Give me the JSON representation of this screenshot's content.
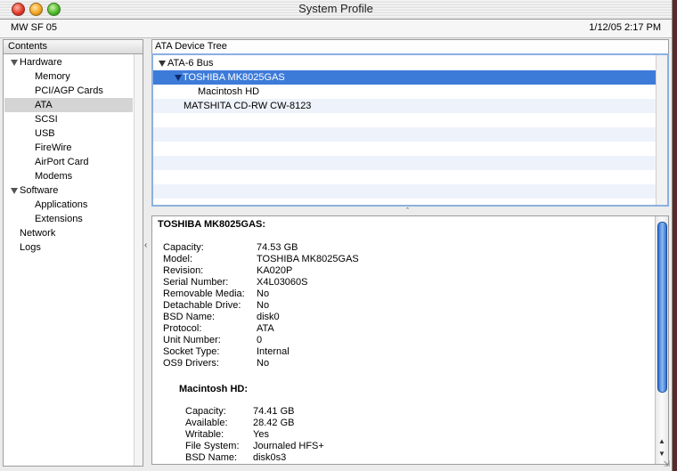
{
  "window": {
    "title": "System Profile",
    "machine_name": "MW SF 05",
    "datetime": "1/12/05 2:17 PM"
  },
  "contents": {
    "header": "Contents",
    "items": [
      {
        "label": "Hardware",
        "level": 0,
        "expanded": true
      },
      {
        "label": "Memory",
        "level": 1
      },
      {
        "label": "PCI/AGP Cards",
        "level": 1
      },
      {
        "label": "ATA",
        "level": 1,
        "selected": true
      },
      {
        "label": "SCSI",
        "level": 1
      },
      {
        "label": "USB",
        "level": 1
      },
      {
        "label": "FireWire",
        "level": 1
      },
      {
        "label": "AirPort Card",
        "level": 1
      },
      {
        "label": "Modems",
        "level": 1
      },
      {
        "label": "Software",
        "level": 0,
        "expanded": true
      },
      {
        "label": "Applications",
        "level": 1
      },
      {
        "label": "Extensions",
        "level": 1
      },
      {
        "label": "Network",
        "level": 0
      },
      {
        "label": "Logs",
        "level": 0
      }
    ]
  },
  "ata_tree": {
    "header": "ATA Device Tree",
    "rows": [
      {
        "label": "ATA-6 Bus"
      },
      {
        "label": "TOSHIBA MK8025GAS",
        "selected": true
      },
      {
        "label": "Macintosh HD"
      },
      {
        "label": "MATSHITA CD-RW CW-8123"
      }
    ]
  },
  "detail": {
    "title": "TOSHIBA MK8025GAS:",
    "fields": [
      {
        "key": "Capacity:",
        "value": "74.53 GB"
      },
      {
        "key": "Model:",
        "value": "TOSHIBA MK8025GAS"
      },
      {
        "key": "Revision:",
        "value": "KA020P"
      },
      {
        "key": "Serial Number:",
        "value": "X4L03060S"
      },
      {
        "key": "Removable Media:",
        "value": "No"
      },
      {
        "key": "Detachable Drive:",
        "value": "No"
      },
      {
        "key": "BSD Name:",
        "value": "disk0"
      },
      {
        "key": "Protocol:",
        "value": "ATA"
      },
      {
        "key": "Unit Number:",
        "value": "0"
      },
      {
        "key": "Socket Type:",
        "value": "Internal"
      },
      {
        "key": "OS9 Drivers:",
        "value": "No"
      }
    ],
    "volume_title": "Macintosh HD:",
    "volume_fields": [
      {
        "key": "Capacity:",
        "value": "74.41 GB"
      },
      {
        "key": "Available:",
        "value": "28.42 GB"
      },
      {
        "key": "Writable:",
        "value": "Yes"
      },
      {
        "key": "File System:",
        "value": "Journaled HFS+"
      },
      {
        "key": "BSD Name:",
        "value": "disk0s3"
      }
    ]
  },
  "colors": {
    "selection": "#3d7bd9",
    "stripe": "#eef3fb",
    "sidebar_selection": "#d4d4d4"
  }
}
